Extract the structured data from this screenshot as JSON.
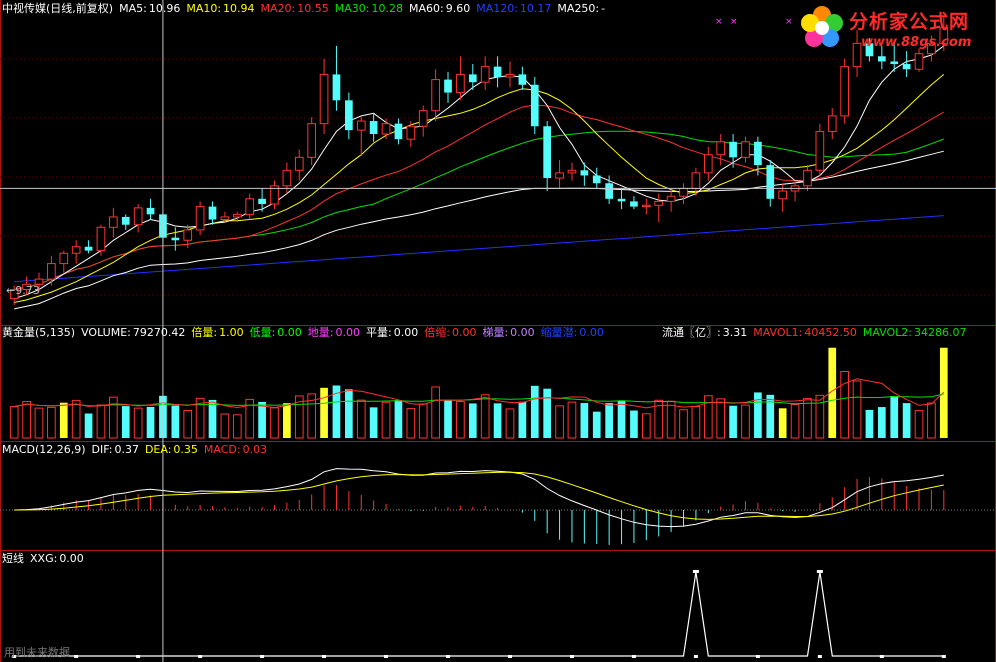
{
  "colors": {
    "up": "#ff3232",
    "down": "#54fcfc",
    "ma5": "#ffffff",
    "ma10": "#ffff00",
    "ma20": "#ff3030",
    "ma30": "#00e000",
    "ma60": "#ffffff",
    "ma120": "#2030ff",
    "grid": "#b01010",
    "vol_yellow": "#ffff30",
    "magenta": "#ff40ff"
  },
  "main_legend": {
    "title": "中视传媒(日线,前复权)",
    "items": [
      {
        "label": "MA5:",
        "value": "10.96",
        "color": "#ffffff"
      },
      {
        "label": "MA10:",
        "value": "10.94",
        "color": "#ffff00"
      },
      {
        "label": "MA20:",
        "value": "10.55",
        "color": "#ff3030"
      },
      {
        "label": "MA30:",
        "value": "10.28",
        "color": "#00e000"
      },
      {
        "label": "MA60:",
        "value": "9.60",
        "color": "#ffffff"
      },
      {
        "label": "MA120:",
        "value": "10.17",
        "color": "#2040ff"
      },
      {
        "label": "MA250:",
        "value": "-",
        "color": "#ffffff"
      }
    ],
    "low_label": "←9.73"
  },
  "volume_legend": {
    "title": "黄金量(5,135)",
    "items": [
      {
        "label": "VOLUME:",
        "value": "79270.42",
        "color": "#ffffff"
      },
      {
        "label": "倍量:",
        "value": "1.00",
        "color": "#ffff00"
      },
      {
        "label": "低量:",
        "value": "0.00",
        "color": "#00ff00"
      },
      {
        "label": "地量:",
        "value": "0.00",
        "color": "#ff40ff"
      },
      {
        "label": "平量:",
        "value": "0.00",
        "color": "#ffffff"
      },
      {
        "label": "倍缩:",
        "value": "0.00",
        "color": "#ff3030"
      },
      {
        "label": "梯量:",
        "value": "0.00",
        "color": "#c080ff"
      },
      {
        "label": "缩量潜:",
        "value": "0.00",
        "color": "#2040ff"
      }
    ],
    "right_items": [
      {
        "label": "流通〖亿〗:",
        "value": "3.31",
        "color": "#ffffff"
      },
      {
        "label": "MAVOL1:",
        "value": "40452.50",
        "color": "#ff3030"
      },
      {
        "label": "MAVOL2:",
        "value": "34286.07",
        "color": "#00e000"
      }
    ]
  },
  "macd_legend": {
    "title": "MACD(12,26,9)",
    "items": [
      {
        "label": "DIF:",
        "value": "0.37",
        "color": "#ffffff"
      },
      {
        "label": "DEA:",
        "value": "0.35",
        "color": "#ffff00"
      },
      {
        "label": "MACD:",
        "value": "0.03",
        "color": "#ff3030"
      }
    ]
  },
  "xxg_legend": {
    "title": "短线",
    "items": [
      {
        "label": "XXG:",
        "value": "0.00",
        "color": "#ffffff"
      }
    ]
  },
  "footer": "用到未来数据",
  "watermark": {
    "title": "分析家公式网",
    "url": "www.88gs.com"
  },
  "crosshair": {
    "bar_index": 12,
    "price": 10.6
  },
  "chart_data": {
    "type": "candlestick",
    "ylim": [
      9.6,
      11.9
    ],
    "candles": [
      {
        "o": 9.75,
        "h": 9.85,
        "l": 9.7,
        "c": 9.82
      },
      {
        "o": 9.82,
        "h": 9.92,
        "l": 9.78,
        "c": 9.86
      },
      {
        "o": 9.86,
        "h": 9.95,
        "l": 9.8,
        "c": 9.9
      },
      {
        "o": 9.9,
        "h": 10.08,
        "l": 9.85,
        "c": 10.02
      },
      {
        "o": 10.02,
        "h": 10.12,
        "l": 9.95,
        "c": 10.1
      },
      {
        "o": 10.1,
        "h": 10.2,
        "l": 10.02,
        "c": 10.15
      },
      {
        "o": 10.15,
        "h": 10.2,
        "l": 10.1,
        "c": 10.12
      },
      {
        "o": 10.12,
        "h": 10.32,
        "l": 10.08,
        "c": 10.3
      },
      {
        "o": 10.3,
        "h": 10.45,
        "l": 10.22,
        "c": 10.38
      },
      {
        "o": 10.38,
        "h": 10.4,
        "l": 10.28,
        "c": 10.32
      },
      {
        "o": 10.32,
        "h": 10.48,
        "l": 10.26,
        "c": 10.45
      },
      {
        "o": 10.45,
        "h": 10.52,
        "l": 10.36,
        "c": 10.4
      },
      {
        "o": 10.4,
        "h": 10.42,
        "l": 10.18,
        "c": 10.22
      },
      {
        "o": 10.22,
        "h": 10.3,
        "l": 10.12,
        "c": 10.2
      },
      {
        "o": 10.2,
        "h": 10.32,
        "l": 10.14,
        "c": 10.28
      },
      {
        "o": 10.28,
        "h": 10.5,
        "l": 10.24,
        "c": 10.46
      },
      {
        "o": 10.46,
        "h": 10.5,
        "l": 10.32,
        "c": 10.36
      },
      {
        "o": 10.36,
        "h": 10.42,
        "l": 10.34,
        "c": 10.38
      },
      {
        "o": 10.38,
        "h": 10.42,
        "l": 10.34,
        "c": 10.4
      },
      {
        "o": 10.4,
        "h": 10.56,
        "l": 10.36,
        "c": 10.52
      },
      {
        "o": 10.52,
        "h": 10.6,
        "l": 10.42,
        "c": 10.48
      },
      {
        "o": 10.48,
        "h": 10.66,
        "l": 10.44,
        "c": 10.62
      },
      {
        "o": 10.62,
        "h": 10.8,
        "l": 10.56,
        "c": 10.74
      },
      {
        "o": 10.74,
        "h": 10.9,
        "l": 10.66,
        "c": 10.84
      },
      {
        "o": 10.84,
        "h": 11.15,
        "l": 10.78,
        "c": 11.1
      },
      {
        "o": 11.1,
        "h": 11.6,
        "l": 11.02,
        "c": 11.48
      },
      {
        "o": 11.48,
        "h": 11.7,
        "l": 11.2,
        "c": 11.28
      },
      {
        "o": 11.28,
        "h": 11.34,
        "l": 10.98,
        "c": 11.05
      },
      {
        "o": 11.05,
        "h": 11.16,
        "l": 10.85,
        "c": 11.12
      },
      {
        "o": 11.12,
        "h": 11.18,
        "l": 10.96,
        "c": 11.02
      },
      {
        "o": 11.02,
        "h": 11.14,
        "l": 10.98,
        "c": 11.1
      },
      {
        "o": 11.1,
        "h": 11.14,
        "l": 10.94,
        "c": 10.98
      },
      {
        "o": 10.98,
        "h": 11.12,
        "l": 10.92,
        "c": 11.08
      },
      {
        "o": 11.08,
        "h": 11.24,
        "l": 11.0,
        "c": 11.2
      },
      {
        "o": 11.2,
        "h": 11.52,
        "l": 11.12,
        "c": 11.44
      },
      {
        "o": 11.44,
        "h": 11.5,
        "l": 11.26,
        "c": 11.34
      },
      {
        "o": 11.34,
        "h": 11.62,
        "l": 11.28,
        "c": 11.48
      },
      {
        "o": 11.48,
        "h": 11.56,
        "l": 11.36,
        "c": 11.42
      },
      {
        "o": 11.42,
        "h": 11.62,
        "l": 11.36,
        "c": 11.54
      },
      {
        "o": 11.54,
        "h": 11.62,
        "l": 11.38,
        "c": 11.46
      },
      {
        "o": 11.46,
        "h": 11.58,
        "l": 11.38,
        "c": 11.48
      },
      {
        "o": 11.48,
        "h": 11.54,
        "l": 11.36,
        "c": 11.4
      },
      {
        "o": 11.4,
        "h": 11.46,
        "l": 11.02,
        "c": 11.08
      },
      {
        "o": 11.08,
        "h": 11.12,
        "l": 10.58,
        "c": 10.68
      },
      {
        "o": 10.68,
        "h": 10.82,
        "l": 10.6,
        "c": 10.72
      },
      {
        "o": 10.72,
        "h": 10.8,
        "l": 10.66,
        "c": 10.74
      },
      {
        "o": 10.74,
        "h": 10.8,
        "l": 10.62,
        "c": 10.7
      },
      {
        "o": 10.7,
        "h": 10.76,
        "l": 10.6,
        "c": 10.64
      },
      {
        "o": 10.64,
        "h": 10.7,
        "l": 10.48,
        "c": 10.52
      },
      {
        "o": 10.52,
        "h": 10.6,
        "l": 10.44,
        "c": 10.5
      },
      {
        "o": 10.5,
        "h": 10.54,
        "l": 10.44,
        "c": 10.46
      },
      {
        "o": 10.46,
        "h": 10.52,
        "l": 10.4,
        "c": 10.47
      },
      {
        "o": 10.47,
        "h": 10.56,
        "l": 10.34,
        "c": 10.5
      },
      {
        "o": 10.5,
        "h": 10.58,
        "l": 10.42,
        "c": 10.54
      },
      {
        "o": 10.54,
        "h": 10.64,
        "l": 10.48,
        "c": 10.6
      },
      {
        "o": 10.6,
        "h": 10.76,
        "l": 10.54,
        "c": 10.72
      },
      {
        "o": 10.72,
        "h": 10.92,
        "l": 10.66,
        "c": 10.86
      },
      {
        "o": 10.86,
        "h": 11.02,
        "l": 10.78,
        "c": 10.96
      },
      {
        "o": 10.96,
        "h": 11.02,
        "l": 10.76,
        "c": 10.84
      },
      {
        "o": 10.84,
        "h": 11.0,
        "l": 10.8,
        "c": 10.96
      },
      {
        "o": 10.96,
        "h": 11.0,
        "l": 10.7,
        "c": 10.78
      },
      {
        "o": 10.78,
        "h": 10.82,
        "l": 10.46,
        "c": 10.52
      },
      {
        "o": 10.52,
        "h": 10.64,
        "l": 10.42,
        "c": 10.58
      },
      {
        "o": 10.58,
        "h": 10.66,
        "l": 10.5,
        "c": 10.62
      },
      {
        "o": 10.62,
        "h": 10.78,
        "l": 10.58,
        "c": 10.74
      },
      {
        "o": 10.74,
        "h": 11.1,
        "l": 10.7,
        "c": 11.04
      },
      {
        "o": 11.04,
        "h": 11.22,
        "l": 10.98,
        "c": 11.16
      },
      {
        "o": 11.16,
        "h": 11.6,
        "l": 11.1,
        "c": 11.54
      },
      {
        "o": 11.54,
        "h": 11.82,
        "l": 11.46,
        "c": 11.72
      },
      {
        "o": 11.72,
        "h": 11.76,
        "l": 11.58,
        "c": 11.62
      },
      {
        "o": 11.62,
        "h": 11.7,
        "l": 11.52,
        "c": 11.58
      },
      {
        "o": 11.58,
        "h": 11.74,
        "l": 11.5,
        "c": 11.56
      },
      {
        "o": 11.56,
        "h": 11.66,
        "l": 11.46,
        "c": 11.52
      },
      {
        "o": 11.52,
        "h": 11.68,
        "l": 11.5,
        "c": 11.64
      },
      {
        "o": 11.64,
        "h": 11.78,
        "l": 11.58,
        "c": 11.72
      },
      {
        "o": 11.72,
        "h": 11.92,
        "l": 11.66,
        "c": 11.84
      }
    ],
    "ma5": [
      9.75,
      9.78,
      9.82,
      9.88,
      9.94,
      10.0,
      10.06,
      10.12,
      10.2,
      10.26,
      10.32,
      10.36,
      10.34,
      10.31,
      10.3,
      10.31,
      10.33,
      10.34,
      10.37,
      10.42,
      10.44,
      10.49,
      10.56,
      10.64,
      10.75,
      10.9,
      11.04,
      11.12,
      11.16,
      11.18,
      11.11,
      11.06,
      11.07,
      11.08,
      11.15,
      11.22,
      11.3,
      11.38,
      11.44,
      11.46,
      11.47,
      11.46,
      11.36,
      11.24,
      11.07,
      10.94,
      10.78,
      10.7,
      10.66,
      10.62,
      10.58,
      10.54,
      10.51,
      10.5,
      10.52,
      10.56,
      10.64,
      10.74,
      10.8,
      10.86,
      10.86,
      10.81,
      10.74,
      10.66,
      10.65,
      10.7,
      10.8,
      10.92,
      11.08,
      11.28,
      11.42,
      11.52,
      11.58,
      11.6,
      11.63,
      11.7
    ],
    "ma10": [
      9.72,
      9.74,
      9.77,
      9.8,
      9.84,
      9.88,
      9.93,
      9.98,
      10.03,
      10.09,
      10.15,
      10.2,
      10.24,
      10.26,
      10.28,
      10.31,
      10.33,
      10.35,
      10.35,
      10.36,
      10.37,
      10.4,
      10.44,
      10.49,
      10.55,
      10.63,
      10.71,
      10.79,
      10.86,
      10.95,
      11.01,
      11.05,
      11.09,
      11.12,
      11.14,
      11.16,
      11.18,
      11.21,
      11.25,
      11.3,
      11.34,
      11.37,
      11.36,
      11.33,
      11.28,
      11.21,
      11.12,
      11.02,
      10.93,
      10.84,
      10.76,
      10.68,
      10.63,
      10.59,
      10.56,
      10.57,
      10.59,
      10.63,
      10.67,
      10.72,
      10.75,
      10.76,
      10.76,
      10.76,
      10.77,
      10.79,
      10.82,
      10.86,
      10.91,
      10.98,
      11.05,
      11.13,
      11.22,
      11.31,
      11.4,
      11.48
    ]
  }
}
